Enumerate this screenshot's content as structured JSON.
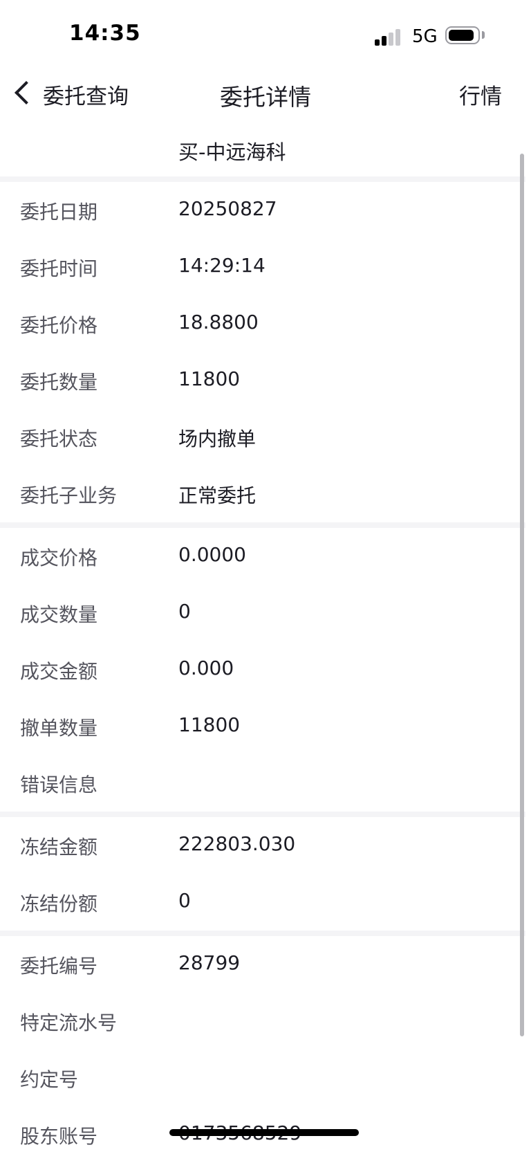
{
  "status_bar": {
    "time": "14:35",
    "network": "5G"
  },
  "nav": {
    "back_label": "委托查询",
    "title": "委托详情",
    "right_label": "行情"
  },
  "stock": {
    "name": "买-中远海科"
  },
  "rows": [
    {
      "label": "委托日期",
      "value": "20250827"
    },
    {
      "label": "委托时间",
      "value": "14:29:14"
    },
    {
      "label": "委托价格",
      "value": "18.8800"
    },
    {
      "label": "委托数量",
      "value": "11800"
    },
    {
      "label": "委托状态",
      "value": "场内撤单"
    },
    {
      "label": "委托子业务",
      "value": "正常委托"
    },
    {
      "label": "成交价格",
      "value": "0.0000"
    },
    {
      "label": "成交数量",
      "value": "0"
    },
    {
      "label": "成交金额",
      "value": "0.000"
    },
    {
      "label": "撤单数量",
      "value": "11800"
    },
    {
      "label": "错误信息",
      "value": ""
    },
    {
      "label": "冻结金额",
      "value": "222803.030"
    },
    {
      "label": "冻结份额",
      "value": "0"
    },
    {
      "label": "委托编号",
      "value": "28799"
    },
    {
      "label": "特定流水号",
      "value": ""
    },
    {
      "label": "约定号",
      "value": ""
    },
    {
      "label": "股东账号",
      "value": "0173568529"
    }
  ]
}
